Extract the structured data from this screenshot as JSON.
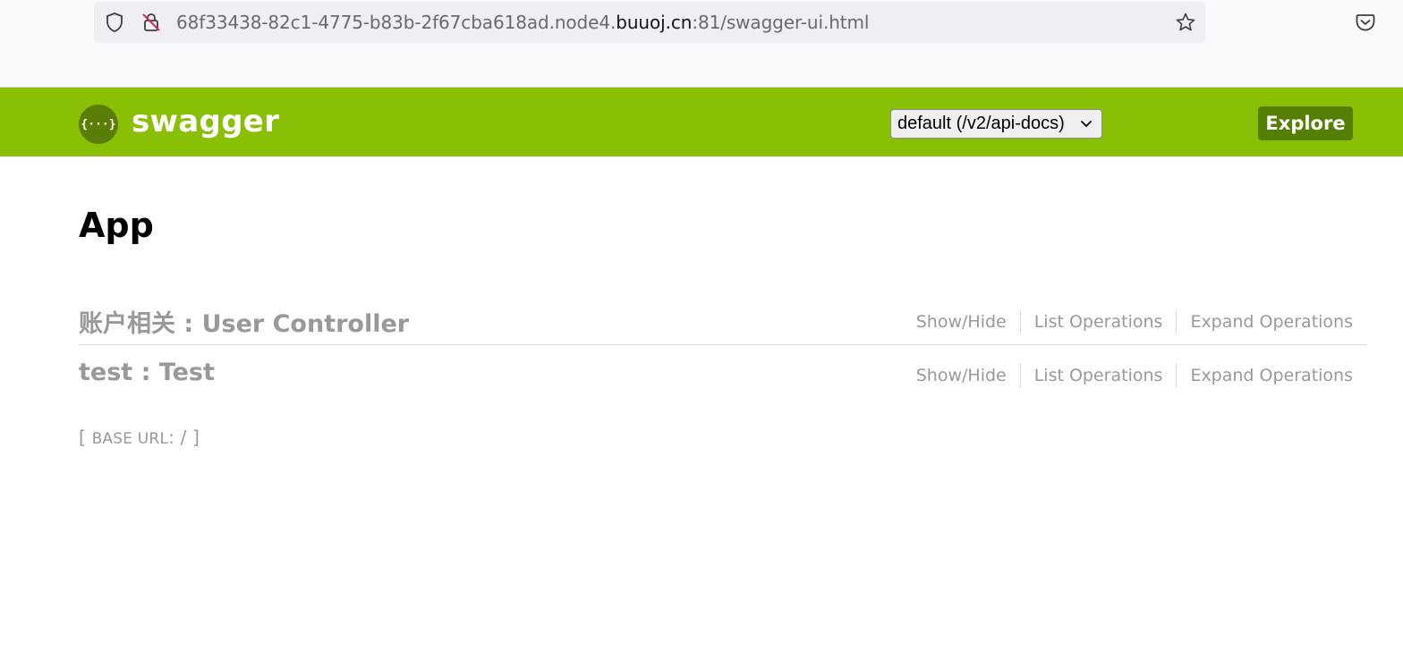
{
  "browser": {
    "url_prefix": "68f33438-82c1-4775-b83b-2f67cba618ad.node4.",
    "url_host": "buuoj.cn",
    "url_suffix": ":81/swagger-ui.html"
  },
  "header": {
    "logo_glyph": "{···}",
    "brand": "swagger",
    "spec_select_value": "default (/v2/api-docs)",
    "explore_label": "Explore",
    "colors": {
      "bar": "#89bf04",
      "explore": "#547f00"
    }
  },
  "main": {
    "title": "App",
    "resources": [
      {
        "title": "账户相关 : User Controller",
        "show_hide": "Show/Hide",
        "list_ops": "List Operations",
        "expand_ops": "Expand Operations"
      },
      {
        "title": "test : Test",
        "show_hide": "Show/Hide",
        "list_ops": "List Operations",
        "expand_ops": "Expand Operations"
      }
    ],
    "base_url_open": "[ ",
    "base_url_label": "BASE URL",
    "base_url_value": ": / ]"
  }
}
